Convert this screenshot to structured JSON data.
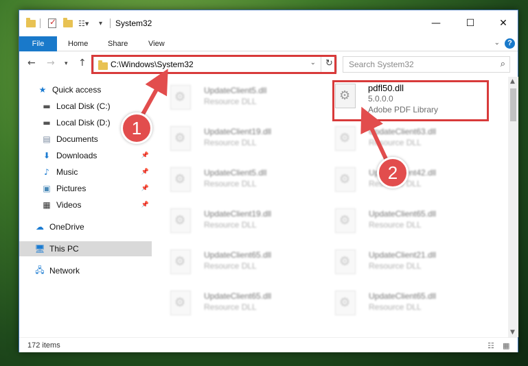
{
  "window": {
    "title": "System32",
    "controls": {
      "minimize": "—",
      "maximize": "☐",
      "close": "✕"
    }
  },
  "ribbon": {
    "tabs": [
      "File",
      "Home",
      "Share",
      "View"
    ],
    "help": "?"
  },
  "navigation": {
    "address_path": "C:\\Windows\\System32",
    "search_placeholder": "Search System32"
  },
  "sidebar": {
    "items": [
      {
        "label": "Quick access",
        "icon": "star-icon",
        "pinned": false
      },
      {
        "label": "Local Disk (C:)",
        "icon": "drive-icon",
        "pinned": false
      },
      {
        "label": "Local Disk (D:)",
        "icon": "drive-icon",
        "pinned": false
      },
      {
        "label": "Documents",
        "icon": "documents-icon",
        "pinned": true
      },
      {
        "label": "Downloads",
        "icon": "download-icon",
        "pinned": true
      },
      {
        "label": "Music",
        "icon": "music-icon",
        "pinned": true
      },
      {
        "label": "Pictures",
        "icon": "pictures-icon",
        "pinned": true
      },
      {
        "label": "Videos",
        "icon": "videos-icon",
        "pinned": true
      },
      {
        "label": "OneDrive",
        "icon": "cloud-icon",
        "pinned": false
      },
      {
        "label": "This PC",
        "icon": "computer-icon",
        "pinned": false,
        "selected": true
      },
      {
        "label": "Network",
        "icon": "network-icon",
        "pinned": false
      }
    ]
  },
  "files": {
    "highlighted": {
      "name": "pdfl50.dll",
      "version": "5.0.0.0",
      "description": "Adobe PDF Library"
    },
    "left_column": [
      {
        "name": "UpdateClient5.dll",
        "type": "Resource DLL"
      },
      {
        "name": "UpdateClient19.dll",
        "type": "Resource DLL"
      },
      {
        "name": "UpdateClient5.dll",
        "type": "Resource DLL"
      },
      {
        "name": "UpdateClient19.dll",
        "type": "Resource DLL"
      },
      {
        "name": "UpdateClient65.dll",
        "type": "Resource DLL"
      },
      {
        "name": "UpdateClient65.dll",
        "type": "Resource DLL"
      }
    ],
    "right_column": [
      {
        "name": "UpdateClient63.dll",
        "type": "Resource DLL"
      },
      {
        "name": "UpdateClient42.dll",
        "type": "Resource DLL"
      },
      {
        "name": "UpdateClient65.dll",
        "type": "Resource DLL"
      },
      {
        "name": "UpdateClient21.dll",
        "type": "Resource DLL"
      },
      {
        "name": "UpdateClient65.dll",
        "type": "Resource DLL"
      }
    ]
  },
  "status": {
    "item_count": "172 items"
  },
  "annotations": {
    "step1": "1",
    "step2": "2",
    "color": "#e24d4d"
  }
}
